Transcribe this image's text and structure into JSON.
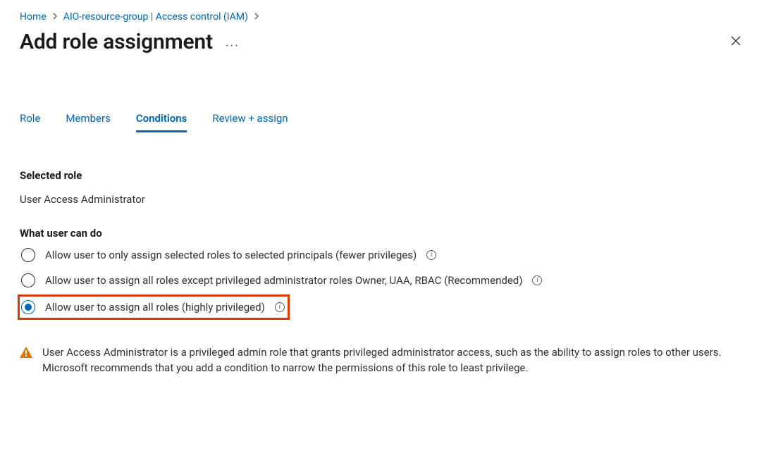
{
  "breadcrumb": {
    "items": [
      {
        "label": "Home"
      },
      {
        "label": "AIO-resource-group | Access control (IAM)"
      }
    ]
  },
  "heading": {
    "title": "Add role assignment"
  },
  "tabs": [
    {
      "label": "Role"
    },
    {
      "label": "Members"
    },
    {
      "label": "Conditions",
      "active": true
    },
    {
      "label": "Review + assign"
    }
  ],
  "selectedRole": {
    "label": "Selected role",
    "value": "User Access Administrator"
  },
  "permissions": {
    "label": "What user can do",
    "options": [
      {
        "label": "Allow user to only assign selected roles to selected principals (fewer privileges)",
        "selected": false,
        "highlighted": false
      },
      {
        "label": "Allow user to assign all roles except privileged administrator roles Owner, UAA, RBAC (Recommended)",
        "selected": false,
        "highlighted": false
      },
      {
        "label": "Allow user to assign all roles (highly privileged)",
        "selected": true,
        "highlighted": true
      }
    ]
  },
  "warning": {
    "text": "User Access Administrator is a privileged admin role that grants privileged administrator access, such as the ability to assign roles to other users. Microsoft recommends that you add a condition to narrow the permissions of this role to least privilege."
  }
}
